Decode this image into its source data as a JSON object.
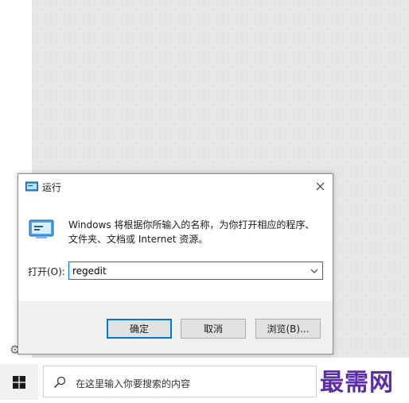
{
  "dialog": {
    "title": "运行",
    "description": "Windows 将根据你所输入的名称，为你打开相应的程序、文件夹、文档或 Internet 资源。",
    "open_label": "打开(O):",
    "open_value": "regedit",
    "buttons": {
      "ok": "确定",
      "cancel": "取消",
      "browse": "浏览(B)..."
    }
  },
  "taskbar": {
    "search_placeholder": "在这里输入你要搜索的内容"
  },
  "watermark": "最需网",
  "colors": {
    "accent": "#0078d7",
    "watermark": "#5b2ea6"
  },
  "icons": [
    "settings-icon",
    "run-app-icon",
    "close-icon",
    "chevron-down-icon",
    "windows-logo-icon",
    "search-icon"
  ]
}
